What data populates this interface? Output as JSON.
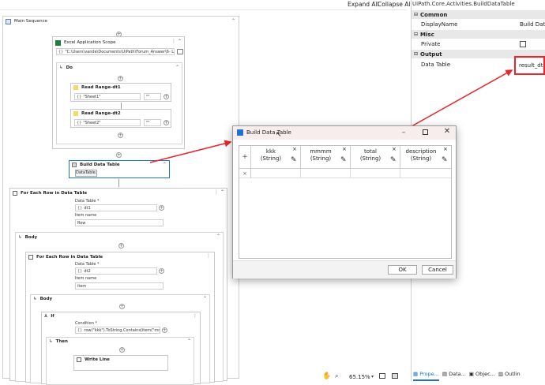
{
  "toolbar": {
    "expand_all": "Expand All",
    "collapse_all": "Collapse All"
  },
  "designer": {
    "main_sequence": "Main Sequence",
    "excel_scope": {
      "title": "Excel Application Scope",
      "path": "\"C:\\Users\\vande\\Documents\\UiPath\\Forum_Answer\\6- Lookl..."
    },
    "do_label": "Do",
    "read_range_1": {
      "title": "Read Range-dt1",
      "sheet": "\"Sheet1\"",
      "range": "\"\""
    },
    "read_range_2": {
      "title": "Read Range-dt2",
      "sheet": "\"Sheet2\"",
      "range": "\"\""
    },
    "build_dt": {
      "title": "Build Data Table",
      "button": "DataTable..."
    },
    "foreach_1": {
      "title": "For Each Row in Data Table",
      "data_table_label": "Data Table *",
      "data_table_value": "dt1",
      "item_name_label": "Item name",
      "item_name_value": "Row"
    },
    "body_label": "Body",
    "foreach_2": {
      "title": "For Each Row in Data Table",
      "data_table_label": "Data Table *",
      "data_table_value": "dt2",
      "item_name_label": "Item name",
      "item_name_value": "item"
    },
    "body2_label": "Body",
    "if_activity": {
      "title": "If",
      "condition_label": "Condition *",
      "condition_value": "row(\"kkk\").ToString.Contains(item(\"mmmm"
    },
    "then_label": "Then",
    "write_line": "Write Line"
  },
  "status_bar": {
    "zoom": "65.15%"
  },
  "properties": {
    "header": "UiPath.Core.Activities.BuildDataTable",
    "sections": {
      "common": "Common",
      "display_name_label": "DisplayName",
      "display_name_value": "Build Data",
      "misc": "Misc",
      "private_label": "Private",
      "output": "Output",
      "data_table_label": "Data Table",
      "data_table_value": "result_dt"
    },
    "tabs": [
      "Prope...",
      "Data...",
      "Objec...",
      "Outlin"
    ]
  },
  "dialog": {
    "title": "Build Data Table",
    "columns": [
      {
        "name": "kkk",
        "type": "(String)"
      },
      {
        "name": "mmmm",
        "type": "(String)"
      },
      {
        "name": "total",
        "type": "(String)"
      },
      {
        "name": "description",
        "type": "(String)"
      }
    ],
    "ok": "OK",
    "cancel": "Cancel"
  },
  "colors": {
    "accent": "#1e73c8",
    "annotation": "#e8262b",
    "dialog_title_bg": "#f7eded"
  }
}
